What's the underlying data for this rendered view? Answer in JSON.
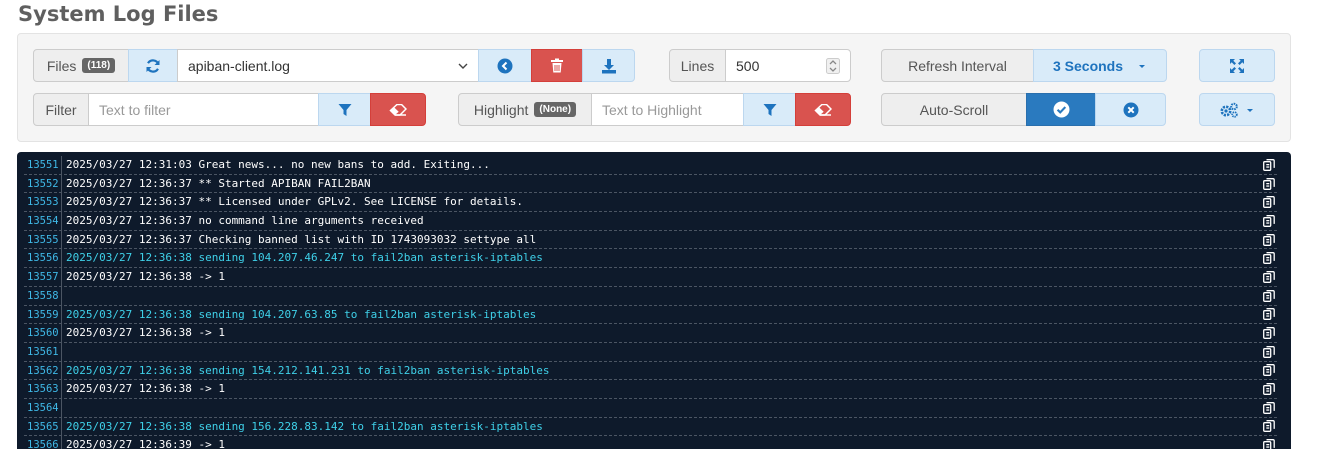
{
  "page_title": "System Log Files",
  "files": {
    "label": "Files",
    "count": "(118)",
    "selected": "apiban-client.log"
  },
  "lines": {
    "label": "Lines",
    "value": "500"
  },
  "refresh": {
    "label": "Refresh Interval",
    "value": "3 Seconds"
  },
  "filter": {
    "label": "Filter",
    "placeholder": "Text to filter"
  },
  "highlight": {
    "label": "Highlight",
    "badge": "(None)",
    "placeholder": "Text to Highlight"
  },
  "autoscroll": {
    "label": "Auto-Scroll"
  },
  "colors": {
    "accent": "#2a7abf",
    "danger": "#d9534f",
    "log_bg": "#0e1a2b",
    "highlight_text": "#3fd0e8"
  },
  "log_rows": [
    {
      "n": "13551",
      "t": "2025/03/27 12:31:03 Great news... no new bans to add. Exiting...",
      "hl": false
    },
    {
      "n": "13552",
      "t": "2025/03/27 12:36:37 ** Started APIBAN FAIL2BAN",
      "hl": false
    },
    {
      "n": "13553",
      "t": "2025/03/27 12:36:37 ** Licensed under GPLv2. See LICENSE for details.",
      "hl": false
    },
    {
      "n": "13554",
      "t": "2025/03/27 12:36:37 no command line arguments received",
      "hl": false
    },
    {
      "n": "13555",
      "t": "2025/03/27 12:36:37 Checking banned list with ID 1743093032 settype all",
      "hl": false
    },
    {
      "n": "13556",
      "t": "2025/03/27 12:36:38 sending 104.207.46.247 to fail2ban asterisk-iptables",
      "hl": true
    },
    {
      "n": "13557",
      "t": "2025/03/27 12:36:38 -> 1",
      "hl": false
    },
    {
      "n": "13558",
      "t": "",
      "hl": false
    },
    {
      "n": "13559",
      "t": "2025/03/27 12:36:38 sending 104.207.63.85 to fail2ban asterisk-iptables",
      "hl": true
    },
    {
      "n": "13560",
      "t": "2025/03/27 12:36:38 -> 1",
      "hl": false
    },
    {
      "n": "13561",
      "t": "",
      "hl": false
    },
    {
      "n": "13562",
      "t": "2025/03/27 12:36:38 sending 154.212.141.231 to fail2ban asterisk-iptables",
      "hl": true
    },
    {
      "n": "13563",
      "t": "2025/03/27 12:36:38 -> 1",
      "hl": false
    },
    {
      "n": "13564",
      "t": "",
      "hl": false
    },
    {
      "n": "13565",
      "t": "2025/03/27 12:36:38 sending 156.228.83.142 to fail2ban asterisk-iptables",
      "hl": true
    },
    {
      "n": "13566",
      "t": "2025/03/27 12:36:39 -> 1",
      "hl": false
    }
  ]
}
